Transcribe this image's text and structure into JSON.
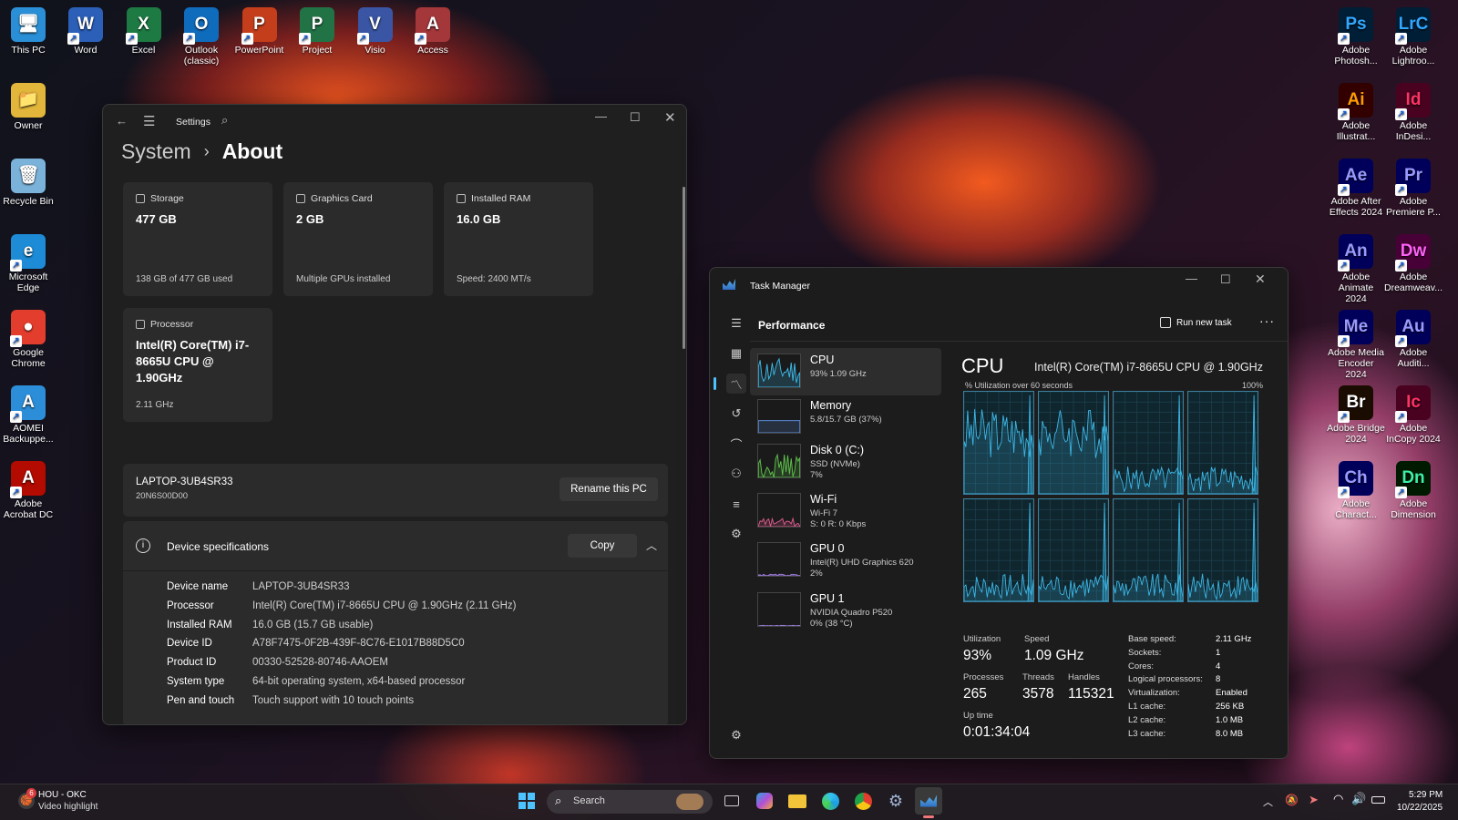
{
  "desktop": {
    "left_icons": [
      {
        "label": "This PC",
        "glyph": "🖥",
        "color": "#2a8fd6"
      },
      {
        "label": "Owner",
        "glyph": "📁",
        "color": "#e2b53b"
      },
      {
        "label": "Recycle Bin",
        "glyph": "🗑",
        "color": "#7bb2d9"
      },
      {
        "label": "Microsoft Edge",
        "glyph": "e",
        "color": "#1d8bd6"
      },
      {
        "label": "Google Chrome",
        "glyph": "●",
        "color": "#e33d2d"
      },
      {
        "label": "AOMEI Backuppe...",
        "glyph": "A",
        "color": "#2c8ed8"
      },
      {
        "label": "Adobe Acrobat DC",
        "glyph": "A",
        "color": "#b30b00"
      }
    ],
    "top_icons": [
      {
        "label": "Word",
        "glyph": "W",
        "color": "#2b5fb8"
      },
      {
        "label": "Excel",
        "glyph": "X",
        "color": "#1d7a43"
      },
      {
        "label": "Outlook (classic)",
        "glyph": "O",
        "color": "#0f6cbd"
      },
      {
        "label": "PowerPoint",
        "glyph": "P",
        "color": "#c43e1c"
      },
      {
        "label": "Project",
        "glyph": "P",
        "color": "#217346"
      },
      {
        "label": "Visio",
        "glyph": "V",
        "color": "#3955a3"
      },
      {
        "label": "Access",
        "glyph": "A",
        "color": "#a4373a"
      }
    ],
    "right_icons": [
      {
        "label": "Adobe Photosh...",
        "glyph": "Ps",
        "color": "#001e36",
        "fg": "#31a8ff"
      },
      {
        "label": "Adobe Lightroo...",
        "glyph": "LrC",
        "color": "#001e36",
        "fg": "#31a8ff"
      },
      {
        "label": "Adobe Illustrat...",
        "glyph": "Ai",
        "color": "#330000",
        "fg": "#ff9a00"
      },
      {
        "label": "Adobe InDesi...",
        "glyph": "Id",
        "color": "#49021f",
        "fg": "#ff3366"
      },
      {
        "label": "Adobe After Effects 2024",
        "glyph": "Ae",
        "color": "#00005b",
        "fg": "#9999ff"
      },
      {
        "label": "Adobe Premiere P...",
        "glyph": "Pr",
        "color": "#00005b",
        "fg": "#9999ff"
      },
      {
        "label": "Adobe Animate 2024",
        "glyph": "An",
        "color": "#00005b",
        "fg": "#9999ff"
      },
      {
        "label": "Adobe Dreamweav...",
        "glyph": "Dw",
        "color": "#470137",
        "fg": "#ff61f6"
      },
      {
        "label": "Adobe Media Encoder 2024",
        "glyph": "Me",
        "color": "#00005b",
        "fg": "#9999ff"
      },
      {
        "label": "Adobe Auditi...",
        "glyph": "Au",
        "color": "#00005b",
        "fg": "#9999ff"
      },
      {
        "label": "Adobe Bridge 2024",
        "glyph": "Br",
        "color": "#1a0c00",
        "fg": "#ffffff"
      },
      {
        "label": "Adobe InCopy 2024",
        "glyph": "Ic",
        "color": "#49021f",
        "fg": "#ff3366"
      },
      {
        "label": "Adobe Charact...",
        "glyph": "Ch",
        "color": "#00005b",
        "fg": "#9999ff"
      },
      {
        "label": "Adobe Dimension",
        "glyph": "Dn",
        "color": "#001a00",
        "fg": "#3df0a6"
      }
    ]
  },
  "settings": {
    "app_title": "Settings",
    "breadcrumb_parent": "System",
    "breadcrumb_sep": "›",
    "breadcrumb_current": "About",
    "cards": [
      {
        "title": "Storage",
        "value": "477 GB",
        "sub": "138 GB of 477 GB used"
      },
      {
        "title": "Graphics Card",
        "value": "2 GB",
        "sub": "Multiple GPUs installed"
      },
      {
        "title": "Installed RAM",
        "value": "16.0 GB",
        "sub": "Speed: 2400 MT/s"
      }
    ],
    "processor_card": {
      "title": "Processor",
      "value": "Intel(R) Core(TM) i7-8665U CPU @ 1.90GHz",
      "sub": "2.11 GHz"
    },
    "pc_name": "LAPTOP-3UB4SR33",
    "pc_model": "20N6S00D00",
    "rename_label": "Rename this PC",
    "device_specs_label": "Device specifications",
    "copy_label": "Copy",
    "specs": [
      {
        "k": "Device name",
        "v": "LAPTOP-3UB4SR33"
      },
      {
        "k": "Processor",
        "v": "Intel(R) Core(TM) i7-8665U CPU @ 1.90GHz (2.11 GHz)"
      },
      {
        "k": "Installed RAM",
        "v": "16.0 GB (15.7 GB usable)"
      },
      {
        "k": "Device ID",
        "v": "A78F7475-0F2B-439F-8C76-E1017B88D5C0"
      },
      {
        "k": "Product ID",
        "v": "00330-52528-80746-AAOEM"
      },
      {
        "k": "System type",
        "v": "64-bit operating system, x64-based processor"
      },
      {
        "k": "Pen and touch",
        "v": "Touch support with 10 touch points"
      }
    ]
  },
  "taskmgr": {
    "title": "Task Manager",
    "section": "Performance",
    "run_new_task": "Run new task",
    "items": [
      {
        "name": "CPU",
        "d1": "93%  1.09 GHz",
        "d2": "",
        "d3": "",
        "color": "#3db8e8"
      },
      {
        "name": "Memory",
        "d1": "5.8/15.7 GB (37%)",
        "d2": "",
        "d3": "",
        "color": "#5b8bd9"
      },
      {
        "name": "Disk 0 (C:)",
        "d1": "SSD (NVMe)",
        "d2": "7%",
        "d3": "",
        "color": "#5ec04b"
      },
      {
        "name": "Wi-Fi",
        "d1": "Wi-Fi 7",
        "d2": "S: 0  R: 0 Kbps",
        "d3": "",
        "color": "#d95c8d"
      },
      {
        "name": "GPU 0",
        "d1": "Intel(R) UHD Graphics 620",
        "d2": "2%",
        "d3": "",
        "color": "#9a7bd9"
      },
      {
        "name": "GPU 1",
        "d1": "NVIDIA Quadro P520",
        "d2": "0%  (38 °C)",
        "d3": "",
        "color": "#9a7bd9"
      }
    ],
    "cpu_title": "CPU",
    "cpu_model": "Intel(R) Core(TM) i7-8665U CPU @ 1.90GHz",
    "util_label": "% Utilization over 60 seconds",
    "util_max": "100%",
    "stats": {
      "utilization_label": "Utilization",
      "utilization": "93%",
      "speed_label": "Speed",
      "speed": "1.09 GHz",
      "processes_label": "Processes",
      "processes": "265",
      "threads_label": "Threads",
      "threads": "3578",
      "handles_label": "Handles",
      "handles": "115321",
      "uptime_label": "Up time",
      "uptime": "0:01:34:04"
    },
    "specs": [
      {
        "k": "Base speed:",
        "v": "2.11 GHz"
      },
      {
        "k": "Sockets:",
        "v": "1"
      },
      {
        "k": "Cores:",
        "v": "4"
      },
      {
        "k": "Logical processors:",
        "v": "8"
      },
      {
        "k": "Virtualization:",
        "v": "Enabled"
      },
      {
        "k": "L1 cache:",
        "v": "256 KB"
      },
      {
        "k": "L2 cache:",
        "v": "1.0 MB"
      },
      {
        "k": "L3 cache:",
        "v": "8.0 MB"
      }
    ]
  },
  "taskbar": {
    "weather_title": "HOU - OKC",
    "weather_sub": "Video highlight",
    "weather_badge": "6",
    "search_label": "Search",
    "time": "5:29 PM",
    "date": "10/22/2025"
  }
}
